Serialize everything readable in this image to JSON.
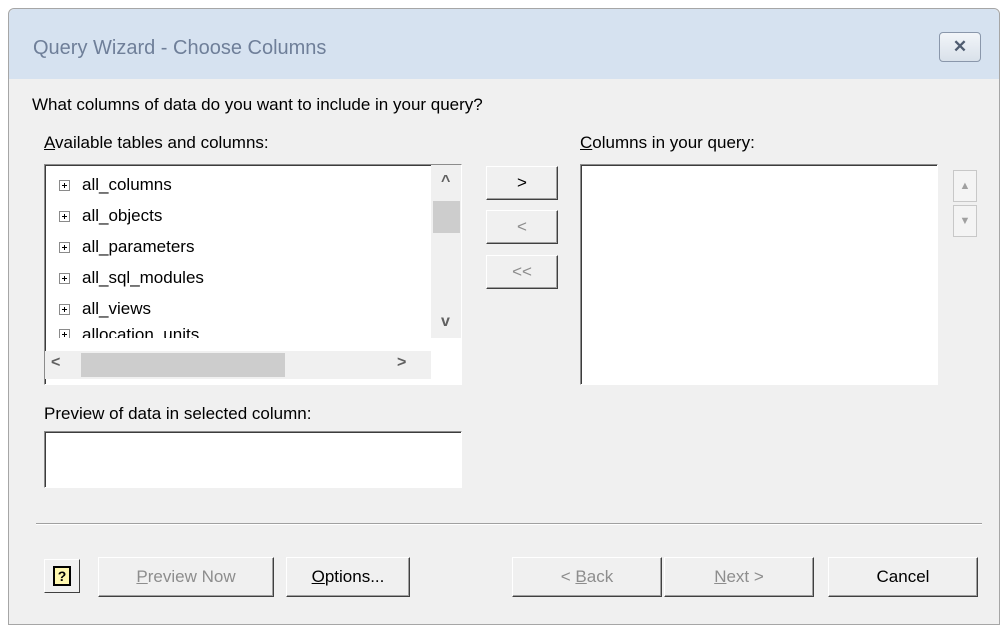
{
  "window": {
    "title": "Query Wizard - Choose Columns",
    "close_glyph": "✕"
  },
  "prompt": "What columns of data do you want to include in your query?",
  "available": {
    "label_accel": "A",
    "label_rest": "vailable tables and columns:",
    "items": [
      "all_columns",
      "all_objects",
      "all_parameters",
      "all_sql_modules",
      "all_views",
      "allocation_units"
    ]
  },
  "query_columns": {
    "label_accel": "C",
    "label_rest": "olumns in your query:",
    "items": []
  },
  "move_buttons": {
    "add": ">",
    "remove": "<",
    "remove_all": "<<"
  },
  "preview": {
    "label": "Preview of data in selected column:",
    "value": ""
  },
  "footer": {
    "help_glyph": "?",
    "preview_now": {
      "accel": "P",
      "rest": "review Now"
    },
    "options": {
      "accel": "O",
      "rest": "ptions..."
    },
    "back": {
      "pre": "< ",
      "accel": "B",
      "rest": "ack"
    },
    "next": {
      "accel": "N",
      "rest": "ext >"
    },
    "cancel": "Cancel"
  },
  "scroll_glyphs": {
    "up": "^",
    "down": "v",
    "left": "<",
    "right": ">",
    "small_up": "▲",
    "small_down": "▼"
  }
}
